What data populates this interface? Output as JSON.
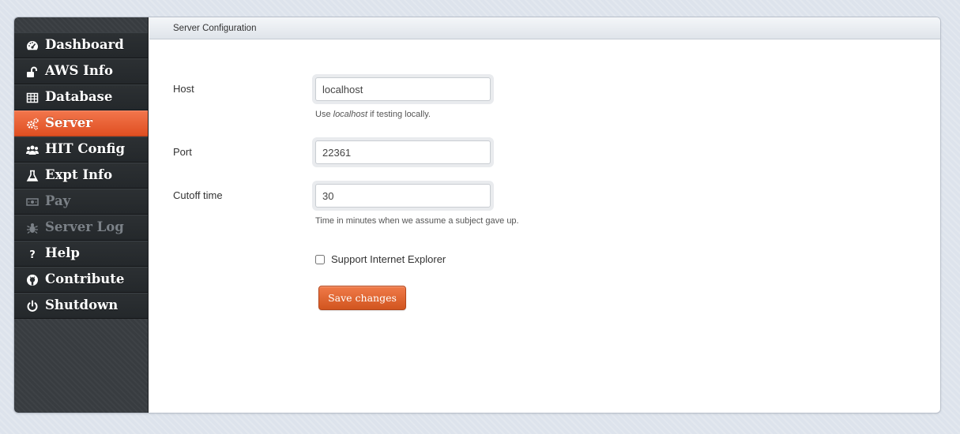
{
  "sidebar": {
    "items": [
      {
        "label": "Dashboard",
        "icon": "dashboard-icon",
        "state": "normal"
      },
      {
        "label": "AWS Info",
        "icon": "unlock-icon",
        "state": "normal"
      },
      {
        "label": "Database",
        "icon": "table-icon",
        "state": "normal"
      },
      {
        "label": "Server",
        "icon": "cogs-icon",
        "state": "active"
      },
      {
        "label": "HIT Config",
        "icon": "group-icon",
        "state": "normal"
      },
      {
        "label": "Expt Info",
        "icon": "flask-icon",
        "state": "normal"
      },
      {
        "label": "Pay",
        "icon": "money-icon",
        "state": "disabled"
      },
      {
        "label": "Server Log",
        "icon": "bug-icon",
        "state": "disabled"
      },
      {
        "label": "Help",
        "icon": "question-icon",
        "state": "normal"
      },
      {
        "label": "Contribute",
        "icon": "github-icon",
        "state": "normal"
      },
      {
        "label": "Shutdown",
        "icon": "power-icon",
        "state": "normal"
      }
    ]
  },
  "header": {
    "title": "Server Configuration"
  },
  "form": {
    "host": {
      "label": "Host",
      "value": "localhost",
      "help_prefix": "Use ",
      "help_em": "localhost",
      "help_suffix": " if testing locally."
    },
    "port": {
      "label": "Port",
      "value": "22361"
    },
    "cutoff": {
      "label": "Cutoff time",
      "value": "30",
      "help": "Time in minutes when we assume a subject gave up."
    },
    "support_ie": {
      "label": "Support Internet Explorer",
      "checked": false
    },
    "save_label": "Save changes"
  },
  "colors": {
    "accent": "#e85b2d",
    "sidebar_bg": "#383c40",
    "background": "#dde3ec"
  }
}
